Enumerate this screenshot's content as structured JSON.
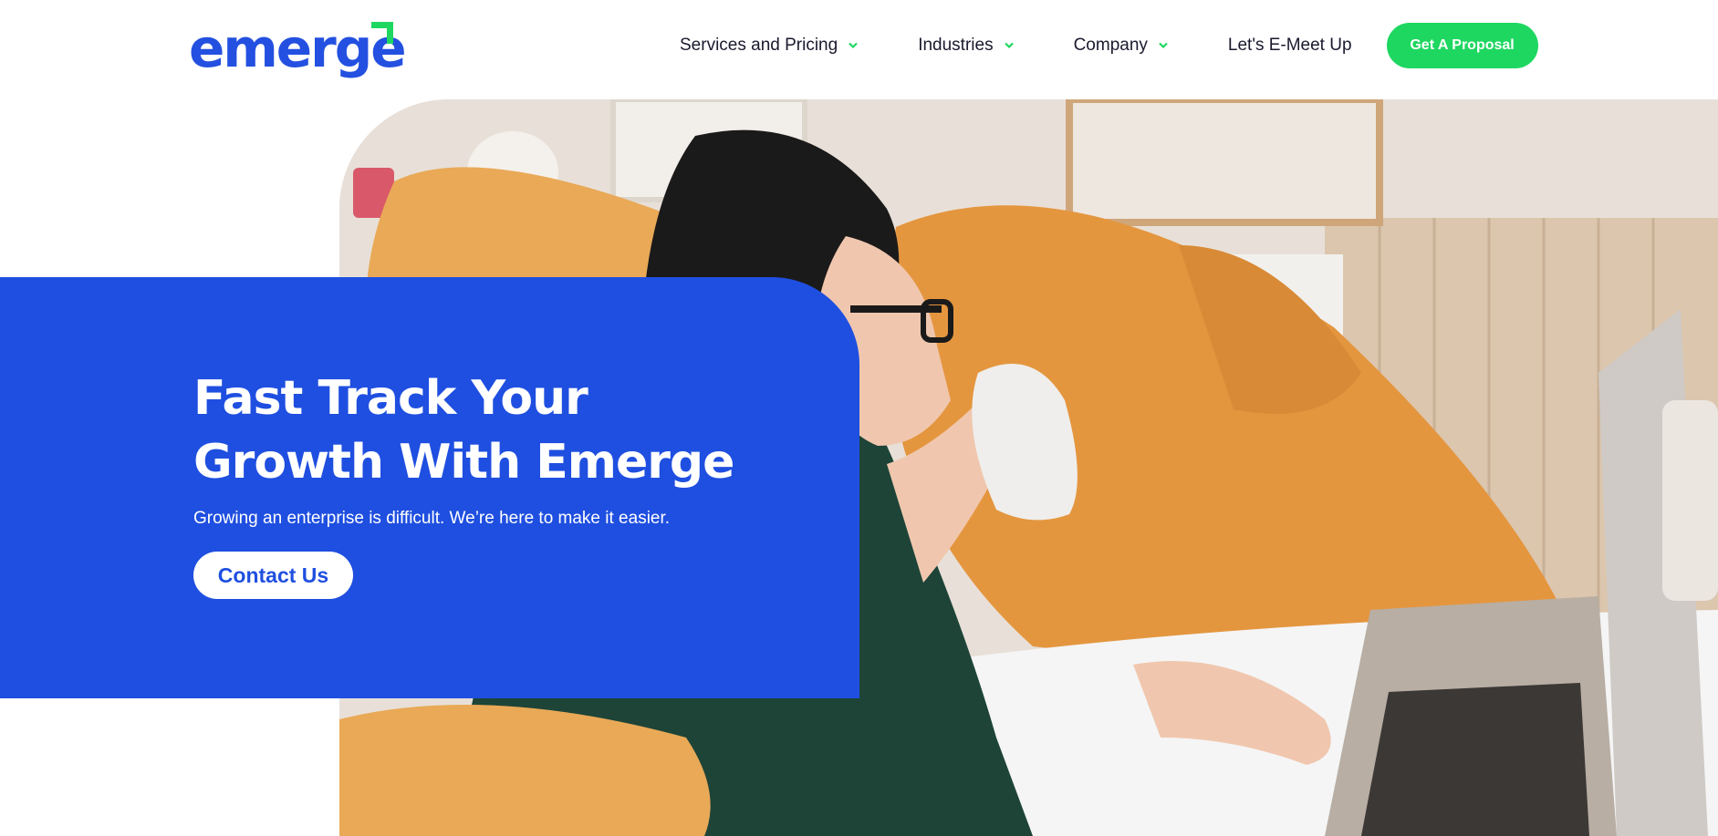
{
  "brand": {
    "logo_text": "emerge",
    "primary_color": "#1f4fe0",
    "accent_color": "#1ed760"
  },
  "nav": {
    "items": [
      {
        "label": "Services and Pricing",
        "has_dropdown": true
      },
      {
        "label": "Industries",
        "has_dropdown": true
      },
      {
        "label": "Company",
        "has_dropdown": true
      },
      {
        "label": "Let's E-Meet Up",
        "has_dropdown": false
      }
    ],
    "cta_label": "Get A Proposal",
    "dropdown_icon": "chevron-down-icon"
  },
  "hero": {
    "title_line1": "Fast Track Your",
    "title_line2": "Growth With Emerge",
    "subtitle": "Growing an enterprise is difficult. We’re here to make it easier.",
    "button_label": "Contact Us"
  }
}
